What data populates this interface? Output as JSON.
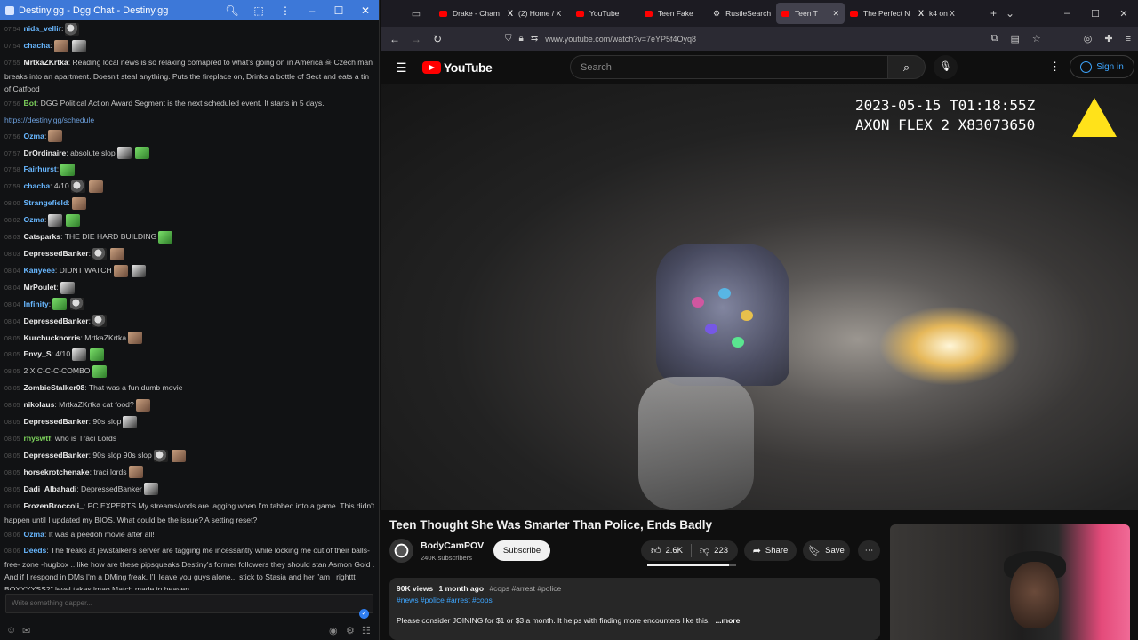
{
  "chat_window": {
    "title": "Destiny.gg - Dgg Chat - Destiny.gg",
    "input_placeholder": "Write something dapper...",
    "lines": [
      {
        "ts": "07:54",
        "name": "nida_vellir",
        "text": ":",
        "cls": "blue",
        "emotes": 1
      },
      {
        "ts": "07:54",
        "name": "chacha",
        "text": ":",
        "cls": "blue",
        "emotes": 2
      },
      {
        "ts": "07:55",
        "name": "MrtkaZKrtka",
        "text": ": Reading local news is so relaxing comapred to what's going on in America ☠ Czech man breaks into an apartment. Doesn't steal anything. Puts the fireplace on, Drinks a bottle of Sect and eats a tin of Catfood",
        "cls": "",
        "wrap": true
      },
      {
        "ts": "07:56",
        "name": "Bot",
        "text": ": DGG Political Action Award Segment is the next scheduled event. It starts in 5 days.",
        "cls": "green",
        "wrap": false
      },
      {
        "ts": "",
        "name": "",
        "text": "https://destiny.gg/schedule",
        "cls": "link"
      },
      {
        "ts": "07:56",
        "name": "Ozma",
        "text": ":",
        "cls": "blue",
        "emotes": 1
      },
      {
        "ts": "07:57",
        "name": "DrOrdinaire",
        "text": ": absolute slop",
        "cls": "",
        "emotes": 2
      },
      {
        "ts": "07:58",
        "name": "Fairhurst",
        "text": ":",
        "cls": "blue",
        "emotes": 1
      },
      {
        "ts": "07:59",
        "name": "chacha",
        "text": ": 4/10",
        "cls": "blue",
        "emotes": 2
      },
      {
        "ts": "08:00",
        "name": "Strangefield",
        "text": ":",
        "cls": "blue",
        "emotes": 1
      },
      {
        "ts": "08:02",
        "name": "Ozma",
        "text": ":",
        "cls": "blue",
        "emotes": 2
      },
      {
        "ts": "08:03",
        "name": "Catsparks",
        "text": ": THE DIE HARD BUILDING",
        "cls": "",
        "emotes": 1
      },
      {
        "ts": "08:03",
        "name": "DepressedBanker",
        "text": ":",
        "cls": "",
        "emotes": 2
      },
      {
        "ts": "08:04",
        "name": "Kanyeee",
        "text": ": DIDNT WATCH",
        "cls": "blue",
        "emotes": 2
      },
      {
        "ts": "08:04",
        "name": "MrPoulet",
        "text": ":",
        "cls": "",
        "emotes": 1
      },
      {
        "ts": "08:04",
        "name": "Infinity",
        "text": ":",
        "cls": "blue",
        "emotes": 2
      },
      {
        "ts": "08:04",
        "name": "DepressedBanker",
        "text": ":",
        "cls": "",
        "emotes": 1
      },
      {
        "ts": "08:05",
        "name": "Kurchucknorris",
        "text": ": MrtkaZKrtka",
        "cls": "",
        "emotes": 1
      },
      {
        "ts": "08:05",
        "name": "Envy_S",
        "text": ": 4/10",
        "cls": "",
        "emotes": 2
      },
      {
        "ts": "08:05",
        "name": "",
        "text": "2 X C-C-C-COMBO",
        "cls": "",
        "emotes": 1
      },
      {
        "ts": "08:05",
        "name": "ZombieStalker08",
        "text": ": That was a fun dumb movie",
        "cls": ""
      },
      {
        "ts": "08:05",
        "name": "nikolaus",
        "text": ": MrtkaZKrtka cat food?",
        "cls": "",
        "emotes": 1
      },
      {
        "ts": "08:05",
        "name": "DepressedBanker",
        "text": ": 90s slop",
        "cls": "",
        "emotes": 1
      },
      {
        "ts": "08:05",
        "name": "rhyswtf",
        "text": ": who is Traci Lords",
        "cls": "green"
      },
      {
        "ts": "08:05",
        "name": "DepressedBanker",
        "text": ": 90s slop 90s slop",
        "cls": "",
        "emotes": 2
      },
      {
        "ts": "08:05",
        "name": "horsekrotchenake",
        "text": ": traci lords",
        "cls": "",
        "emotes": 1
      },
      {
        "ts": "08:05",
        "name": "Dadi_Albahadi",
        "text": ": DepressedBanker",
        "cls": "",
        "emotes": 1
      },
      {
        "ts": "08:06",
        "name": "FrozenBroccoli_",
        "text": ": PC EXPERTS My streams/vods are lagging when I'm tabbed into a game. This didn't happen until I updated my BIOS. What could be the issue? A setting reset?",
        "cls": "",
        "wrap": true
      },
      {
        "ts": "08:06",
        "name": "Ozma",
        "text": ": It was a peedoh movie after all!",
        "cls": "blue"
      },
      {
        "ts": "08:06",
        "name": "Deeds",
        "text": ": The freaks at jewstalker's server are tagging me incessantly while locking me out of their balls-free- zone -hugbox ...like how are these pipsqueaks Destiny's former followers they should stan Asmon Gold . And if I respond in DMs I'm a DMing freak. I'll leave you guys alone... stick to Stasia and her \"am I righttt BOYYYYSS?\" level takes lmao Match made in heaven",
        "cls": "blue",
        "wrap": true
      },
      {
        "ts": "08:07",
        "name": "MrtkaZKrtka",
        "text": ": nikolaus Bro was craving",
        "cls": ""
      }
    ]
  },
  "browser": {
    "tabs": [
      {
        "label": "Drake - Cham",
        "fav": "yt",
        "active": false
      },
      {
        "label": "(2) Home / X",
        "fav": "x",
        "active": false
      },
      {
        "label": "YouTube",
        "fav": "yt",
        "active": false
      },
      {
        "label": "Teen Fake",
        "fav": "yt",
        "active": false
      },
      {
        "label": "RustleSearch",
        "fav": "gear",
        "active": false
      },
      {
        "label": "Teen T",
        "fav": "yt",
        "active": true
      },
      {
        "label": "The Perfect N",
        "fav": "yt",
        "active": false
      },
      {
        "label": "k4 on X",
        "fav": "x",
        "active": false
      }
    ],
    "url": "www.youtube.com/watch?v=7eYP5f4Oyq8"
  },
  "youtube": {
    "logo_text": "YouTube",
    "search_placeholder": "Search",
    "sign_in_label": "Sign in",
    "video_overlay_line1": "2023-05-15 T01:18:55Z",
    "video_overlay_line2": "AXON FLEX 2 X83073650",
    "title": "Teen Thought She Was Smarter Than Police, Ends Badly",
    "channel_name": "BodyCamPOV",
    "channel_subs": "240K subscribers",
    "subscribe_label": "Subscribe",
    "likes": "2.6K",
    "dislikes": "223",
    "like_ratio": 0.92,
    "share_label": "Share",
    "save_label": "Save",
    "views": "90K views",
    "posted": "1 month ago",
    "inline_tags": "#cops #arrest #police",
    "tags_line": "#news #police #arrest #cops",
    "description": "Please consider JOINING for $1 or $3 a month. It helps with finding more encounters like this.",
    "more_label": "...more"
  },
  "colors": {
    "accent_blue": "#3d78d8",
    "yt_red": "#ff0000",
    "link_blue": "#3ea6ff"
  }
}
